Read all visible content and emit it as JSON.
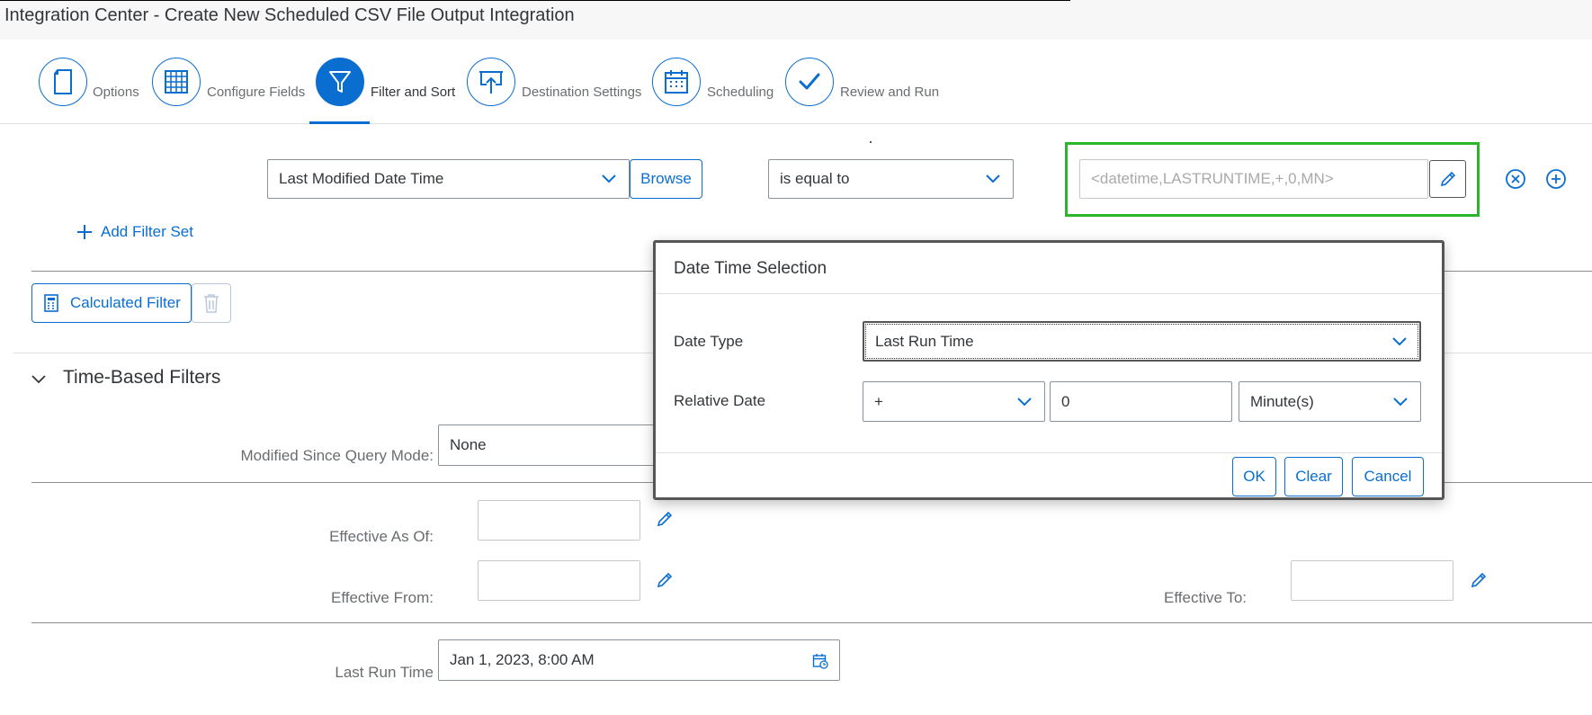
{
  "header": {
    "title": "Integration Center - Create New Scheduled CSV File Output Integration"
  },
  "wizard": {
    "steps": [
      {
        "label": "Options",
        "icon": "document-icon"
      },
      {
        "label": "Configure Fields",
        "icon": "table-grid-icon"
      },
      {
        "label": "Filter and Sort",
        "icon": "filter-icon",
        "active": true
      },
      {
        "label": "Destination Settings",
        "icon": "upload-board-icon"
      },
      {
        "label": "Scheduling",
        "icon": "calendar-icon"
      },
      {
        "label": "Review and Run",
        "icon": "checkmark-icon"
      }
    ]
  },
  "filter": {
    "field": "Last Modified Date Time",
    "browse_label": "Browse",
    "operator": "is equal to",
    "value_placeholder": "<datetime,LASTRUNTIME,+,0,MN>",
    "add_filter_set": "Add Filter Set",
    "calculated_filter": "Calculated Filter"
  },
  "time_based": {
    "title": "Time-Based Filters",
    "modified_since_label": "Modified Since Query Mode:",
    "modified_since_value": "None",
    "effective_as_of_label": "Effective As Of:",
    "effective_from_label": "Effective From:",
    "effective_to_label": "Effective To:",
    "last_run_time_label": "Last Run Time",
    "last_run_time_value": "Jan 1, 2023, 8:00 AM"
  },
  "dialog": {
    "title": "Date Time Selection",
    "date_type_label": "Date Type",
    "date_type_value": "Last Run Time",
    "relative_date_label": "Relative Date",
    "relative_sign": "+",
    "relative_amount": "0",
    "relative_unit": "Minute(s)",
    "ok_label": "OK",
    "clear_label": "Clear",
    "cancel_label": "Cancel"
  },
  "colors": {
    "accent": "#0a6ed1",
    "highlight_border": "#2bb52b"
  }
}
